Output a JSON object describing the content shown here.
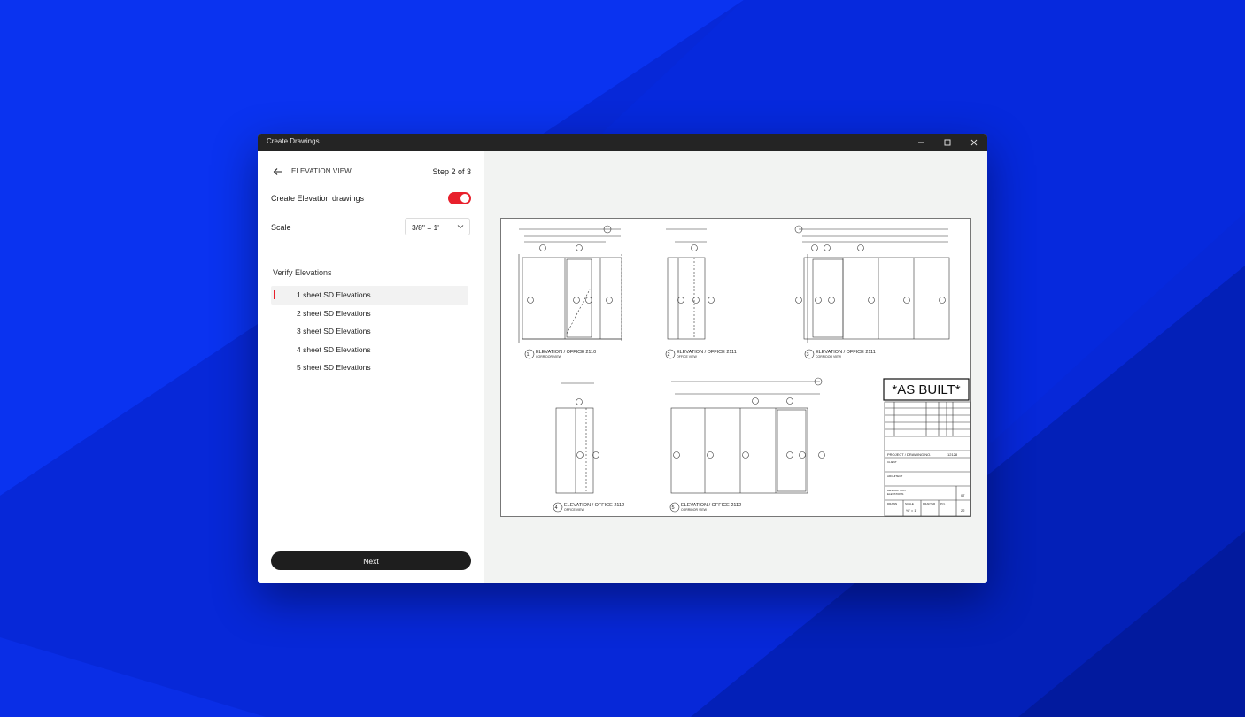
{
  "window": {
    "title": "Create Drawings"
  },
  "panel": {
    "view_title": "ELEVATION VIEW",
    "step": "Step 2 of 3",
    "create_label": "Create Elevation drawings",
    "create_enabled": true,
    "scale_label": "Scale",
    "scale_value": "3/8\" = 1'",
    "verify_title": "Verify Elevations",
    "elevations": [
      {
        "label": "1 sheet SD Elevations",
        "selected": true
      },
      {
        "label": "2 sheet SD Elevations",
        "selected": false
      },
      {
        "label": "3 sheet SD Elevations",
        "selected": false
      },
      {
        "label": "4 sheet SD Elevations",
        "selected": false
      },
      {
        "label": "5 sheet SD Elevations",
        "selected": false
      }
    ],
    "next_label": "Next"
  },
  "drawing": {
    "stamp": "*AS BUILT*",
    "views": [
      {
        "num": "1",
        "title": "ELEVATION / OFFICE 2110",
        "sub": "CORRIDOR VIEW"
      },
      {
        "num": "2",
        "title": "ELEVATION / OFFICE  2111",
        "sub": "OFFICE VIEW"
      },
      {
        "num": "3",
        "title": "ELEVATION / OFFICE  2111",
        "sub": "CORRIDOR VIEW"
      },
      {
        "num": "4",
        "title": "ELEVATION / OFFICE  2112",
        "sub": "OFFICE VIEW"
      },
      {
        "num": "5",
        "title": "ELEVATION / OFFICE  2112",
        "sub": "CORRIDOR VIEW"
      }
    ],
    "title_block": {
      "project_label": "PROJECT / DRAWING NO.",
      "project_no": "12128",
      "client_label": "CLIENT",
      "architect_label": "ARCHITECT",
      "description_label": "DESCRIPTION",
      "description_value": "ELEVATIONS",
      "drawn_label": "DRAWN",
      "scale_label": "SCALE",
      "scale_value": "⅜\" = 1'",
      "drafter_label": "DRAFTER",
      "pn_label": "P.N.",
      "sheet_a": "07",
      "sheet_b": "22"
    }
  },
  "colors": {
    "accent": "#e8202c",
    "background": "#0a2ee6",
    "titlebar": "#242424",
    "button": "#1e1e1e"
  }
}
